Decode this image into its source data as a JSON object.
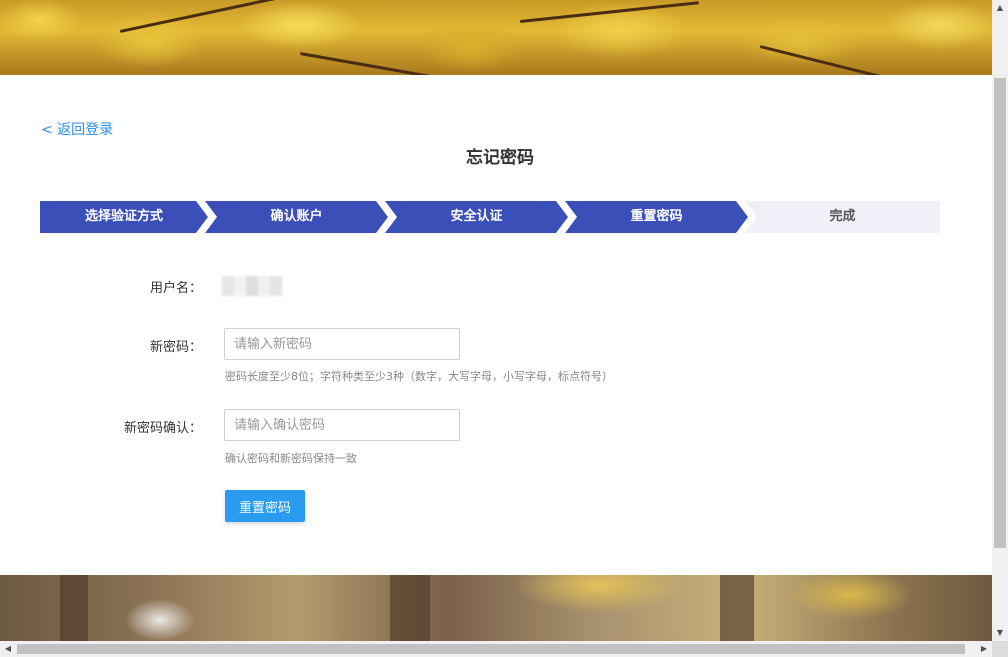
{
  "back_link": "< 返回登录",
  "page_title": "忘记密码",
  "steps": [
    {
      "label": "选择验证方式"
    },
    {
      "label": "确认账户"
    },
    {
      "label": "安全认证"
    },
    {
      "label": "重置密码"
    },
    {
      "label": "完成"
    }
  ],
  "form": {
    "username_label": "用户名：",
    "new_password_label": "新密码：",
    "new_password_placeholder": "请输入新密码",
    "new_password_hint": "密码长度至少8位；字符种类至少3种（数字，大写字母，小写字母，标点符号）",
    "confirm_label": "新密码确认：",
    "confirm_placeholder": "请输入确认密码",
    "confirm_hint": "确认密码和新密码保持一致",
    "submit_label": "重置密码"
  },
  "colors": {
    "step_active": "#3b4fb8",
    "step_pending": "#f0f0f8",
    "link": "#2a8ff0",
    "button": "#2a9cf0"
  }
}
